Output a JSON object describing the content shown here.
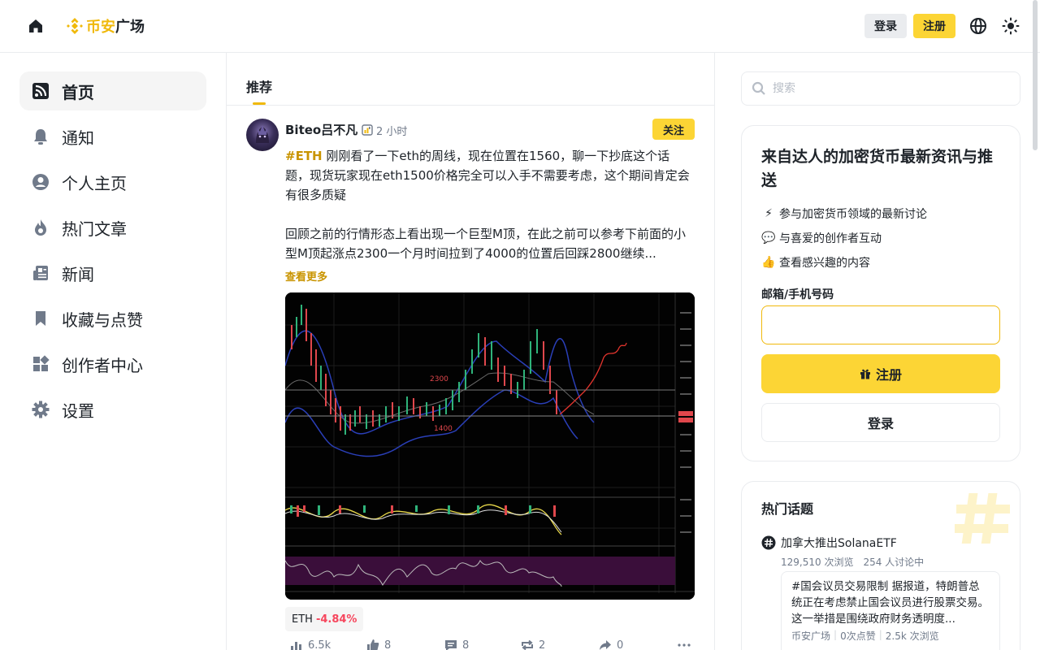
{
  "header": {
    "logo_text_yellow": "币安",
    "logo_text_black": "广场",
    "login_label": "登录",
    "register_label": "注册"
  },
  "sidebar": {
    "items": [
      {
        "label": "首页",
        "icon": "feed-icon",
        "active": true
      },
      {
        "label": "通知",
        "icon": "bell-icon"
      },
      {
        "label": "个人主页",
        "icon": "user-icon"
      },
      {
        "label": "热门文章",
        "icon": "fire-icon"
      },
      {
        "label": "新闻",
        "icon": "news-icon"
      },
      {
        "label": "收藏与点赞",
        "icon": "bookmark-icon"
      },
      {
        "label": "创作者中心",
        "icon": "dashboard-icon"
      },
      {
        "label": "设置",
        "icon": "gear-icon"
      }
    ]
  },
  "feed": {
    "tab": "推荐",
    "post": {
      "author": "Biteo吕不凡",
      "time": "2 小时",
      "follow": "关注",
      "tag": "#ETH",
      "para1": " 刚刚看了一下eth的周线，现在位置在1560，聊一下抄底这个话题，现货玩家现在eth1500价格完全可以入手不需要考虑，这个期间肯定会有很多质疑",
      "para2": "回顾之前的行情形态上看出现一个巨型M顶，在此之前可以参考下前面的小型M顶起涨点2300一个月时间拉到了4000的位置后回踩2800继续...",
      "read_more": "查看更多",
      "coin": "ETH",
      "coin_change": "-4.84%",
      "views": "6.5k",
      "likes": "8",
      "comments": "8",
      "reposts": "2",
      "shares": "0",
      "chart_labels": {
        "level_high": "2300",
        "level_low": "1400"
      }
    }
  },
  "right": {
    "search_placeholder": "搜索",
    "promo": {
      "title": "来自达人的加密货币最新资讯与推送",
      "bullets": [
        {
          "emoji": "⚡",
          "text": "参与加密货币领域的最新讨论"
        },
        {
          "emoji": "💬",
          "text": "与喜爱的创作者互动"
        },
        {
          "emoji": "👍",
          "text": "查看感兴趣的内容"
        }
      ],
      "field_label": "邮箱/手机号码",
      "register": "注册",
      "login": "登录"
    },
    "topics": {
      "title": "热门话题",
      "item": {
        "name": "加拿大推出SolanaETF",
        "views": "129,510 次浏览",
        "discuss": "254 人讨论中",
        "card_text": "#国会议员交易限制 据报道，特朗普总统正在考虑禁止国会议员进行股票交易。这一举措是围绕政府财务透明度...",
        "card_source": "币安广场",
        "card_likes": "0次点赞",
        "card_views": "2.5k 次浏览"
      }
    }
  },
  "colors": {
    "accent": "#fcd535",
    "accent_text": "#c99400",
    "down": "#f6465d"
  }
}
